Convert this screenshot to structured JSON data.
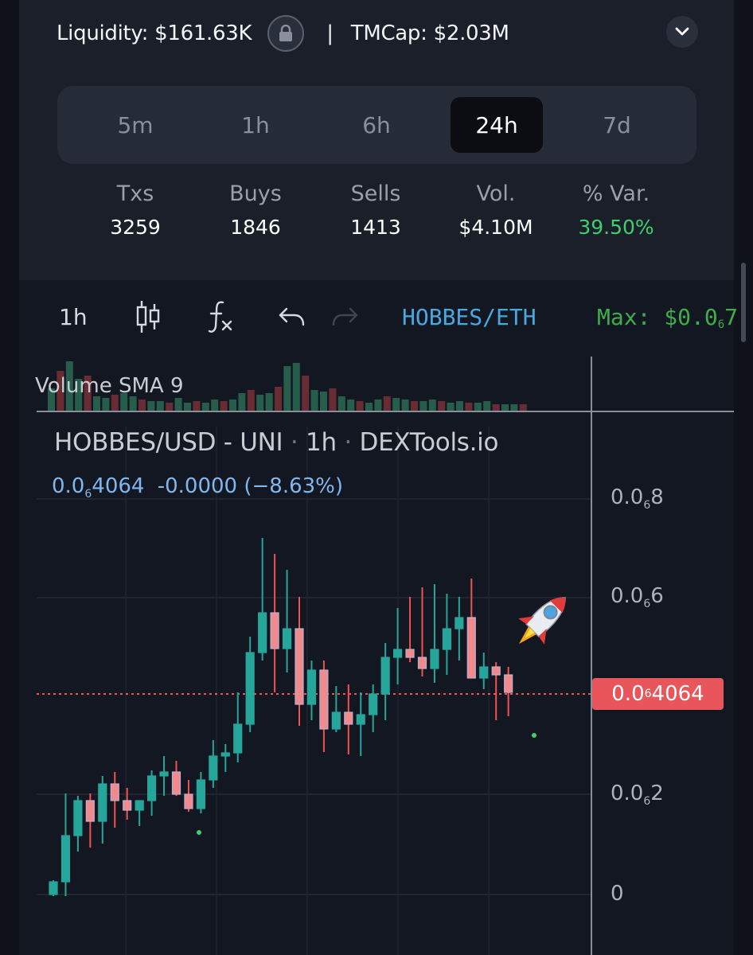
{
  "header": {
    "liquidity_label": "Liquidity:",
    "liquidity_value": "$161.63K",
    "separator": "|",
    "tmcap_label": "TMCap:",
    "tmcap_value": "$2.03M"
  },
  "timeframes": {
    "items": [
      "5m",
      "1h",
      "6h",
      "24h",
      "7d"
    ],
    "active": "24h"
  },
  "stats": {
    "txs": {
      "label": "Txs",
      "value": "3259"
    },
    "buys": {
      "label": "Buys",
      "value": "1846"
    },
    "sells": {
      "label": "Sells",
      "value": "1413"
    },
    "vol": {
      "label": "Vol.",
      "value": "$4.10M"
    },
    "var": {
      "label": "% Var.",
      "value": "39.50%"
    }
  },
  "toolbar": {
    "interval": "1h",
    "pair": "HOBBES/ETH",
    "max_label": "Max: $0.0",
    "max_sub": "6",
    "max_tail": "7"
  },
  "chart": {
    "volume_label": "Volume SMA 9",
    "title_pair": "HOBBES/USD",
    "title_dash": "-",
    "title_dex": "UNI",
    "title_interval": "1h",
    "title_source": "DEXTools.io",
    "dot": "·",
    "quote_price_prefix": "0.0",
    "quote_price_sub": "6",
    "quote_price_tail": "4064",
    "quote_change": "-0.0000",
    "quote_pct": "(−8.63%)",
    "axis": [
      {
        "prefix": "0.0",
        "sub": "6",
        "tail": "8"
      },
      {
        "prefix": "0.0",
        "sub": "6",
        "tail": "6"
      },
      {
        "prefix": "0.0",
        "sub": "6",
        "tail": "2"
      },
      {
        "prefix": "0",
        "sub": "",
        "tail": ""
      }
    ],
    "last_price": {
      "prefix": "0.0",
      "sub": "6",
      "tail": "4064"
    },
    "up_color": "#26a69a",
    "down_color": "#ef5350"
  }
}
